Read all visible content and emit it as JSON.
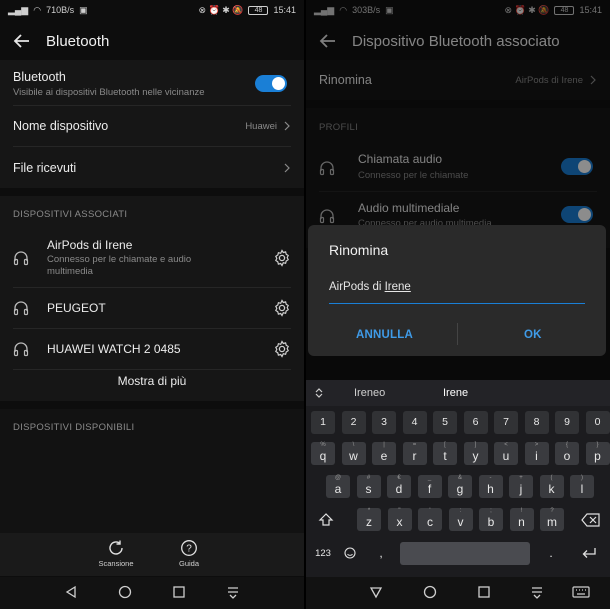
{
  "left": {
    "status": {
      "speed": "710B/s",
      "battery": "48",
      "time": "15:41"
    },
    "title": "Bluetooth",
    "bluetooth": {
      "label": "Bluetooth",
      "sub": "Visibile ai dispositivi Bluetooth nelle vicinanze",
      "enabled": true
    },
    "device_name": {
      "label": "Nome dispositivo",
      "value": "Huawei"
    },
    "received_files": {
      "label": "File ricevuti"
    },
    "paired_header": "DISPOSITIVI ASSOCIATI",
    "paired": [
      {
        "name": "AirPods di Irene",
        "desc": "Connesso per le chiamate e audio multimedia"
      },
      {
        "name": "PEUGEOT",
        "desc": ""
      },
      {
        "name": "HUAWEI WATCH 2 0485",
        "desc": ""
      }
    ],
    "show_more": "Mostra di più",
    "available_header": "DISPOSITIVI DISPONIBILI",
    "bottom": {
      "scan": "Scansione",
      "help": "Guida"
    }
  },
  "right": {
    "status": {
      "speed": "303B/s",
      "battery": "48",
      "time": "15:41"
    },
    "title": "Dispositivo Bluetooth associato",
    "rename": {
      "label": "Rinomina",
      "value": "AirPods di Irene"
    },
    "profiles_header": "PROFILI",
    "profiles": [
      {
        "name": "Chiamata audio",
        "desc": "Connesso per le chiamate",
        "enabled": true
      },
      {
        "name": "Audio multimediale",
        "desc": "Connesso per audio multimedia",
        "enabled": true
      }
    ],
    "dialog": {
      "title": "Rinomina",
      "value_prefix": "AirPods di ",
      "value_word": "Irene",
      "cancel": "ANNULLA",
      "ok": "OK"
    },
    "keyboard": {
      "suggestions": [
        "Ireneo",
        "Irene"
      ],
      "numbers": [
        "1",
        "2",
        "3",
        "4",
        "5",
        "6",
        "7",
        "8",
        "9",
        "0"
      ],
      "row1": [
        [
          "q",
          "%"
        ],
        [
          "w",
          "\\"
        ],
        [
          "e",
          "|"
        ],
        [
          "r",
          "="
        ],
        [
          "t",
          "["
        ],
        [
          "y",
          "]"
        ],
        [
          "u",
          "<"
        ],
        [
          "i",
          ">"
        ],
        [
          "o",
          "{"
        ],
        [
          "p",
          "}"
        ]
      ],
      "row2": [
        [
          "a",
          "@"
        ],
        [
          "s",
          "#"
        ],
        [
          "d",
          "€"
        ],
        [
          "f",
          "_"
        ],
        [
          "g",
          "&"
        ],
        [
          "h",
          "-"
        ],
        [
          "j",
          "+"
        ],
        [
          "k",
          "("
        ],
        [
          "l",
          ")"
        ]
      ],
      "row3": [
        [
          "z",
          "*"
        ],
        [
          "x",
          "\""
        ],
        [
          "c",
          "'"
        ],
        [
          "v",
          ":"
        ],
        [
          "b",
          ";"
        ],
        [
          "n",
          "!"
        ],
        [
          "m",
          "?"
        ]
      ],
      "sym_label": "123",
      "comma": ",",
      "period": "."
    }
  },
  "colors": {
    "accent": "#1a7fd6",
    "dialog_button": "#3f9be8"
  }
}
